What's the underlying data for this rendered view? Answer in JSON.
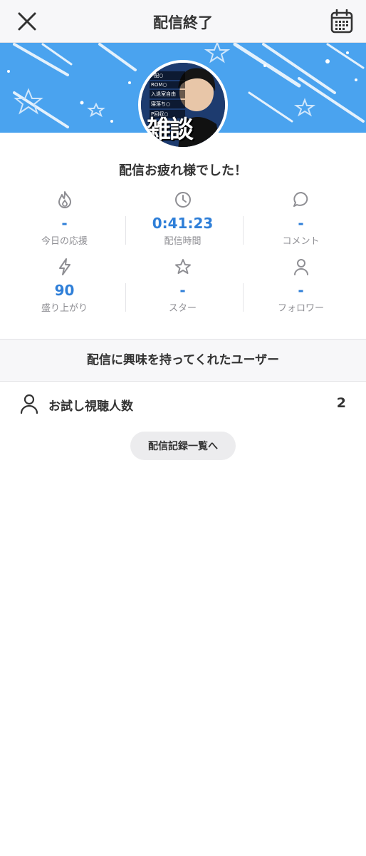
{
  "header": {
    "title": "配信終了",
    "close_icon": "close-icon",
    "calendar_icon": "calendar-icon"
  },
  "avatar": {
    "big_text": "雑談",
    "tags": [
      "P配○",
      "ROM○",
      "入退室自由",
      "寝落ち○",
      "P回収○"
    ]
  },
  "colors": {
    "banner": "#4aa3ef",
    "accent_value": "#2f7fd8"
  },
  "thanks": "配信お疲れ様でした！",
  "stats": [
    {
      "icon": "flame-icon",
      "value": "-",
      "label": "今日の応援"
    },
    {
      "icon": "clock-icon",
      "value": "0:41:23",
      "label": "配信時間"
    },
    {
      "icon": "speech-bubble-icon",
      "value": "-",
      "label": "コメント"
    },
    {
      "icon": "lightning-icon",
      "value": "90",
      "label": "盛り上がり"
    },
    {
      "icon": "star-icon",
      "value": "-",
      "label": "スター"
    },
    {
      "icon": "person-icon",
      "value": "-",
      "label": "フォロワー"
    }
  ],
  "interested_section": {
    "heading": "配信に興味を持ってくれたユーザー",
    "row_label": "お試し視聴人数",
    "row_count": "2",
    "row_icon": "person-icon"
  },
  "history_button": "配信記録一覧へ"
}
